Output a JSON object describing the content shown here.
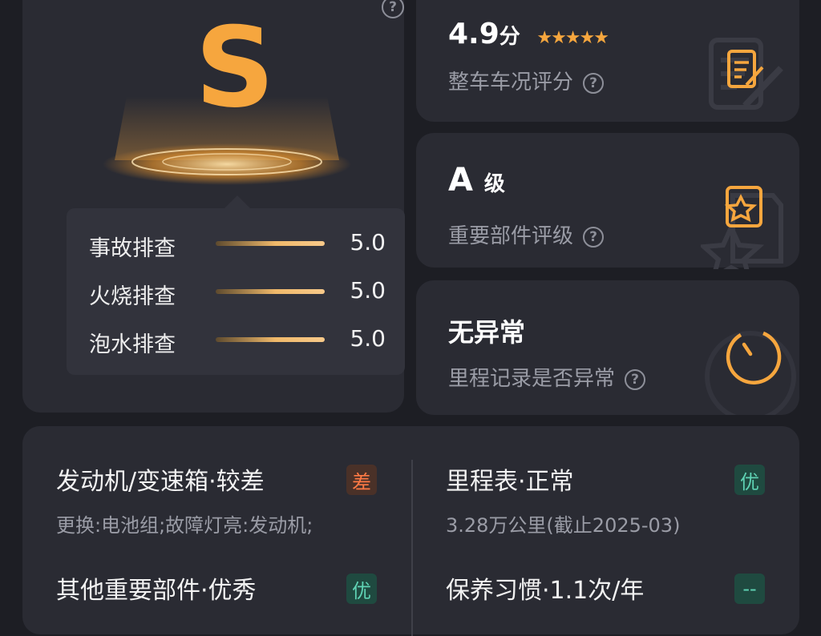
{
  "grade_card": {
    "grade": "S",
    "checks": [
      {
        "label": "事故排查",
        "value": "5.0"
      },
      {
        "label": "火烧排查",
        "value": "5.0"
      },
      {
        "label": "泡水排查",
        "value": "5.0"
      }
    ]
  },
  "score_card": {
    "score": "4.9",
    "score_unit": "分",
    "stars": 5,
    "subtitle": "整车车况评分"
  },
  "level_card": {
    "level": "A",
    "level_unit": "级",
    "subtitle": "重要部件评级"
  },
  "odo_card": {
    "status": "无异常",
    "subtitle": "里程记录是否异常"
  },
  "details": [
    {
      "title": "发动机/变速箱·较差",
      "sub": "更换:电池组;故障灯亮:发动机;",
      "badge": "差"
    },
    {
      "title": "里程表·正常",
      "sub": "3.28万公里(截止2025-03)",
      "badge": "优"
    },
    {
      "title": "其他重要部件·优秀",
      "sub": "",
      "badge": "优"
    },
    {
      "title": "保养习惯·1.1次/年",
      "sub": "",
      "badge": "--"
    }
  ],
  "colors": {
    "accent": "#f6a63e",
    "bad": "#ff7a45",
    "good": "#5fd3b4"
  },
  "icons": {
    "help": "question-circle-icon",
    "score": "document-edit-icon",
    "level": "star-document-icon",
    "odo": "gauge-icon"
  }
}
